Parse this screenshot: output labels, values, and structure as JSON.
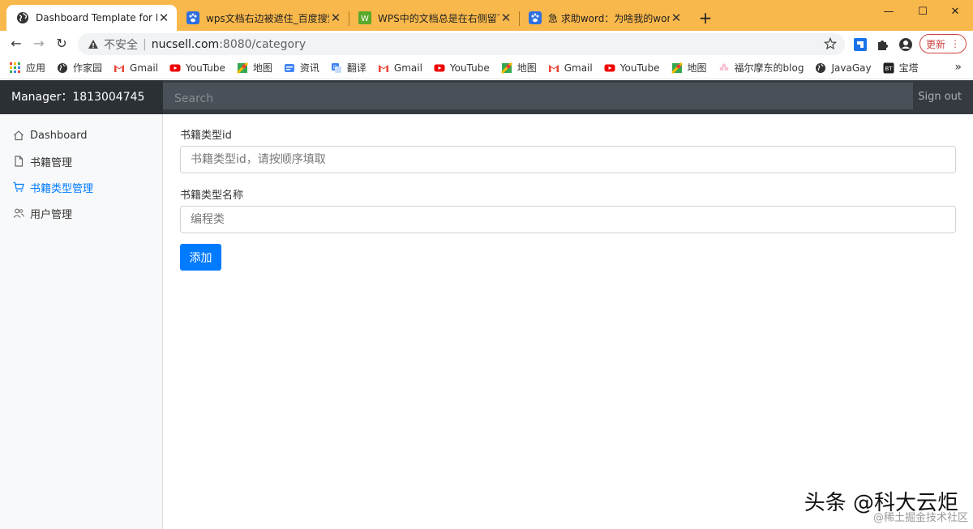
{
  "browser": {
    "tabs": [
      {
        "title": "Dashboard Template for Bootstrap",
        "icon": "globe-icon"
      },
      {
        "title": "wps文档右边被遮住_百度搜索",
        "icon": "baidu-paw-icon"
      },
      {
        "title": "WPS中的文档总是在右侧留下空白",
        "icon": "wps-icon"
      },
      {
        "title": "急 求助word：为啥我的word打开",
        "icon": "baidu-paw-icon"
      }
    ],
    "new_tab": "+",
    "address": {
      "insecure_label": "不安全",
      "host": "nucsell.com",
      "path": ":8080/category"
    },
    "update_label": "更新",
    "bookmarks": [
      {
        "label": "应用",
        "icon": "apps-grid-icon"
      },
      {
        "label": "作家园",
        "icon": "globe-dark-icon"
      },
      {
        "label": "Gmail",
        "icon": "gmail-icon"
      },
      {
        "label": "YouTube",
        "icon": "youtube-icon"
      },
      {
        "label": "地图",
        "icon": "maps-icon"
      },
      {
        "label": "资讯",
        "icon": "news-icon"
      },
      {
        "label": "翻译",
        "icon": "translate-icon"
      },
      {
        "label": "Gmail",
        "icon": "gmail-icon"
      },
      {
        "label": "YouTube",
        "icon": "youtube-icon"
      },
      {
        "label": "地图",
        "icon": "maps-icon"
      },
      {
        "label": "Gmail",
        "icon": "gmail-icon"
      },
      {
        "label": "YouTube",
        "icon": "youtube-icon"
      },
      {
        "label": "地图",
        "icon": "maps-icon"
      },
      {
        "label": "福尔摩东的blog",
        "icon": "blossom-icon"
      },
      {
        "label": "JavaGay",
        "icon": "globe-dark-icon"
      },
      {
        "label": "宝塔",
        "icon": "bt-icon"
      }
    ]
  },
  "header": {
    "brand": "Manager：1813004745",
    "search_placeholder": "Search",
    "signout": "Sign out"
  },
  "sidebar": {
    "items": [
      {
        "label": "Dashboard",
        "icon": "home-icon",
        "active": false
      },
      {
        "label": "书籍管理",
        "icon": "file-icon",
        "active": false
      },
      {
        "label": "书籍类型管理",
        "icon": "cart-icon",
        "active": true
      },
      {
        "label": "用户管理",
        "icon": "users-icon",
        "active": false
      }
    ]
  },
  "form": {
    "id_label": "书籍类型id",
    "id_placeholder": "书籍类型id，请按顺序填取",
    "name_label": "书籍类型名称",
    "name_placeholder": "编程类",
    "submit_label": "添加"
  },
  "watermark": {
    "main": "头条 @科大云炬",
    "sub": "@稀土掘金技术社区"
  },
  "colors": {
    "tabstrip": "#f9b84b",
    "navbar": "#343a40",
    "primary": "#007bff"
  }
}
